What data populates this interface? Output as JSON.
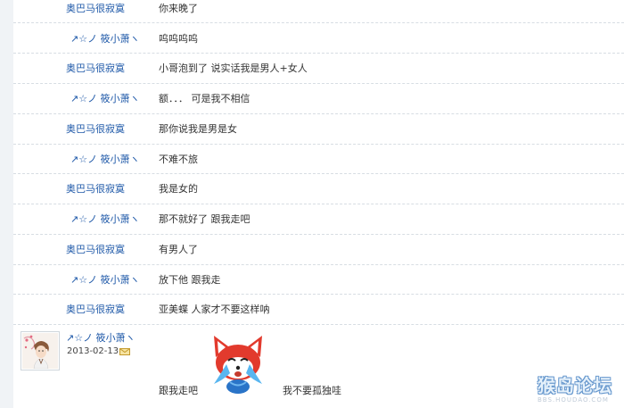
{
  "thread": {
    "users": {
      "a": "奥巴马很寂寞",
      "b": "↗☆ノ 筱小萧ヽ"
    },
    "rows": [
      {
        "user": "奥巴马很寂寞",
        "msg": "你来晚了"
      },
      {
        "user": "↗☆ノ 筱小萧ヽ",
        "msg": "呜呜呜呜"
      },
      {
        "user": "奥巴马很寂寞",
        "msg": "小哥泡到了 说实话我是男人+女人"
      },
      {
        "user": "↗☆ノ 筱小萧ヽ",
        "msg": "额．．．     可是我不相信"
      },
      {
        "user": "奥巴马很寂寞",
        "msg": "那你说我是男是女"
      },
      {
        "user": "↗☆ノ 筱小萧ヽ",
        "msg": "不难不旅"
      },
      {
        "user": "奥巴马很寂寞",
        "msg": "我是女的"
      },
      {
        "user": "↗☆ノ 筱小萧ヽ",
        "msg": "那不就好了   跟我走吧"
      },
      {
        "user": "奥巴马很寂寞",
        "msg": "有男人了"
      },
      {
        "user": "↗☆ノ 筱小萧ヽ",
        "msg": "放下他    跟我走"
      },
      {
        "user": "奥巴马很寂寞",
        "msg": "亚美蝶 人家才不要这样呐"
      }
    ],
    "last_post": {
      "user": "↗☆ノ 筱小萧ヽ",
      "date": "2013-02-13",
      "msg_left": "跟我走吧",
      "msg_right": "我不要孤独哇"
    }
  },
  "watermark": {
    "main": "猴岛论坛",
    "sub": "BBS.HOUDAO.COM"
  },
  "icons": {
    "mail": "envelope-icon",
    "sticker": "crying-fox-sticker",
    "avatar": "user-avatar"
  },
  "colors": {
    "username": "#1e58a8",
    "text": "#333333",
    "separator": "#d7dde3"
  }
}
